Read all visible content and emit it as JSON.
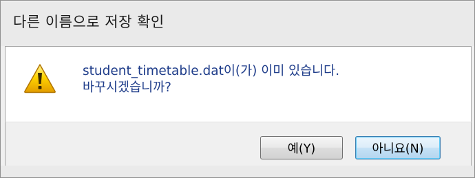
{
  "dialog": {
    "title": "다른 이름으로 저장 확인",
    "message_line1": "student_timetable.dat이(가) 이미 있습니다.",
    "message_line2": "바꾸시겠습니까?",
    "icon": "warning-icon",
    "buttons": {
      "yes_label": "예(Y)",
      "no_label": "아니요(N)"
    }
  },
  "colors": {
    "message_text": "#1f3d8a",
    "warning_fill": "#f5c400",
    "focus_border": "#3c7fb1"
  }
}
